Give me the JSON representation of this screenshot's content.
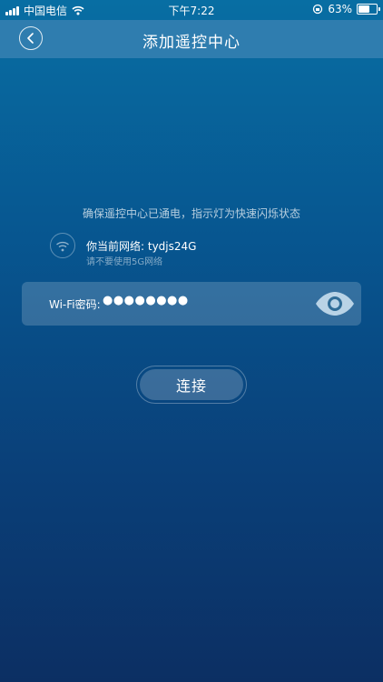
{
  "status_bar": {
    "carrier": "中国电信",
    "time": "下午7:22",
    "battery_percent": "63%",
    "battery_level": 0.63
  },
  "nav": {
    "title": "添加遥控中心"
  },
  "content": {
    "instruction": "确保遥控中心已通电，指示灯为快速闪烁状态",
    "network_label": "你当前网络: tydjs24G",
    "network_hint": "请不要使用5G网络",
    "password_label": "Wi-Fi密码:",
    "password_value": "●●●●●●●●",
    "connect_label": "连接"
  },
  "colors": {
    "background_top": "#086ea3",
    "background_bottom": "#0c2f63",
    "nav_bar": "#2f7daf"
  },
  "icons": [
    "signal-icon",
    "wifi-status-icon",
    "orientation-lock-icon",
    "battery-icon",
    "back-icon",
    "wifi-icon",
    "eye-icon"
  ]
}
